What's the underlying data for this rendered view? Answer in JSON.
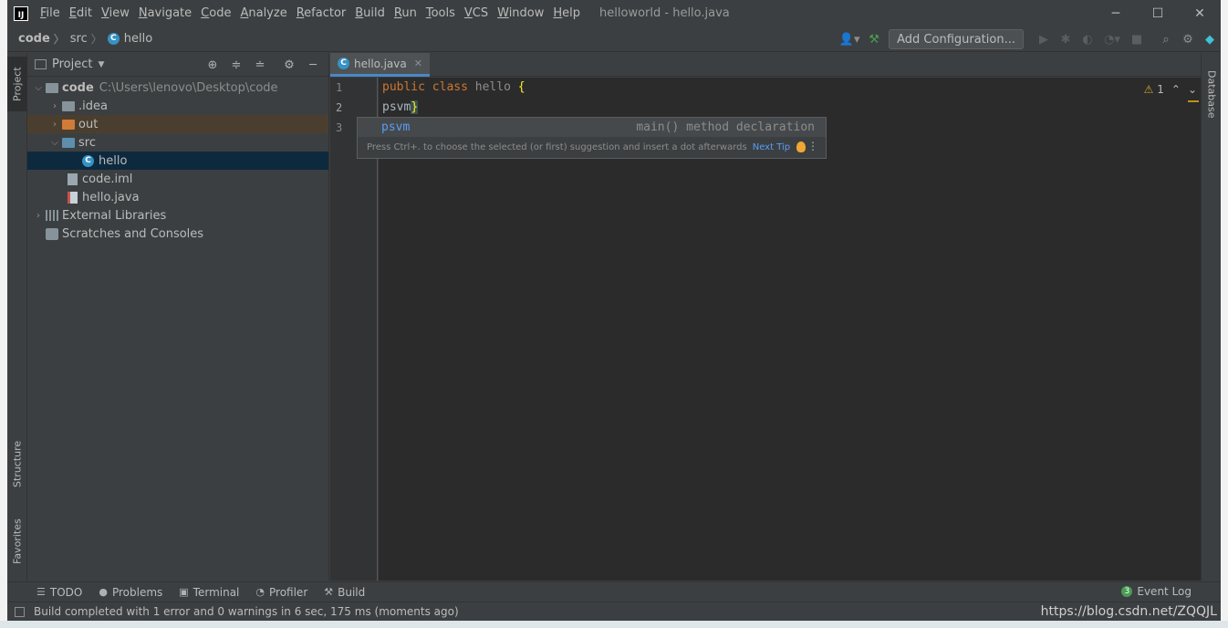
{
  "window": {
    "title": "helloworld - hello.java",
    "menu": [
      "File",
      "Edit",
      "View",
      "Navigate",
      "Code",
      "Analyze",
      "Refactor",
      "Build",
      "Run",
      "Tools",
      "VCS",
      "Window",
      "Help"
    ],
    "controls": {
      "minimize": "─",
      "maximize": "☐",
      "close": "✕"
    },
    "logo": "IJ"
  },
  "navbar": {
    "breadcrumb": [
      "code",
      "src",
      "hello"
    ],
    "add_configuration": "Add Configuration..."
  },
  "left_tabs": {
    "project": "Project",
    "structure": "Structure",
    "favorites": "Favorites"
  },
  "project": {
    "title": "Project",
    "tree": [
      {
        "label": "code",
        "hint": "C:\\Users\\lenovo\\Desktop\\code"
      },
      {
        "label": ".idea"
      },
      {
        "label": "out"
      },
      {
        "label": "src"
      },
      {
        "label": "hello"
      },
      {
        "label": "code.iml"
      },
      {
        "label": "hello.java"
      },
      {
        "label": "External Libraries"
      },
      {
        "label": "Scratches and Consoles"
      }
    ]
  },
  "editor": {
    "tab": "hello.java",
    "line_numbers": [
      "1",
      "2",
      "3"
    ],
    "line1": {
      "kw1": "public",
      "kw2": "class",
      "name": "hello",
      "brace": "{"
    },
    "line2": {
      "text": "psvm",
      "brace": "}"
    },
    "warnings": "1",
    "completion": {
      "item": "psvm",
      "desc": "main() method declaration",
      "tip": "Press Ctrl+. to choose the selected (or first) suggestion and insert a dot afterwards",
      "next_tip": "Next Tip"
    }
  },
  "right_tabs": {
    "database": "Database"
  },
  "toolbar_bottom": {
    "todo": "TODO",
    "problems": "Problems",
    "terminal": "Terminal",
    "profiler": "Profiler",
    "build": "Build",
    "event_log": "Event Log",
    "event_count": "3"
  },
  "status": {
    "message": "Build completed with 1 error and 0 warnings in 6 sec, 175 ms (moments ago)",
    "watermark": "https://blog.csdn.net/ZQQJL"
  }
}
